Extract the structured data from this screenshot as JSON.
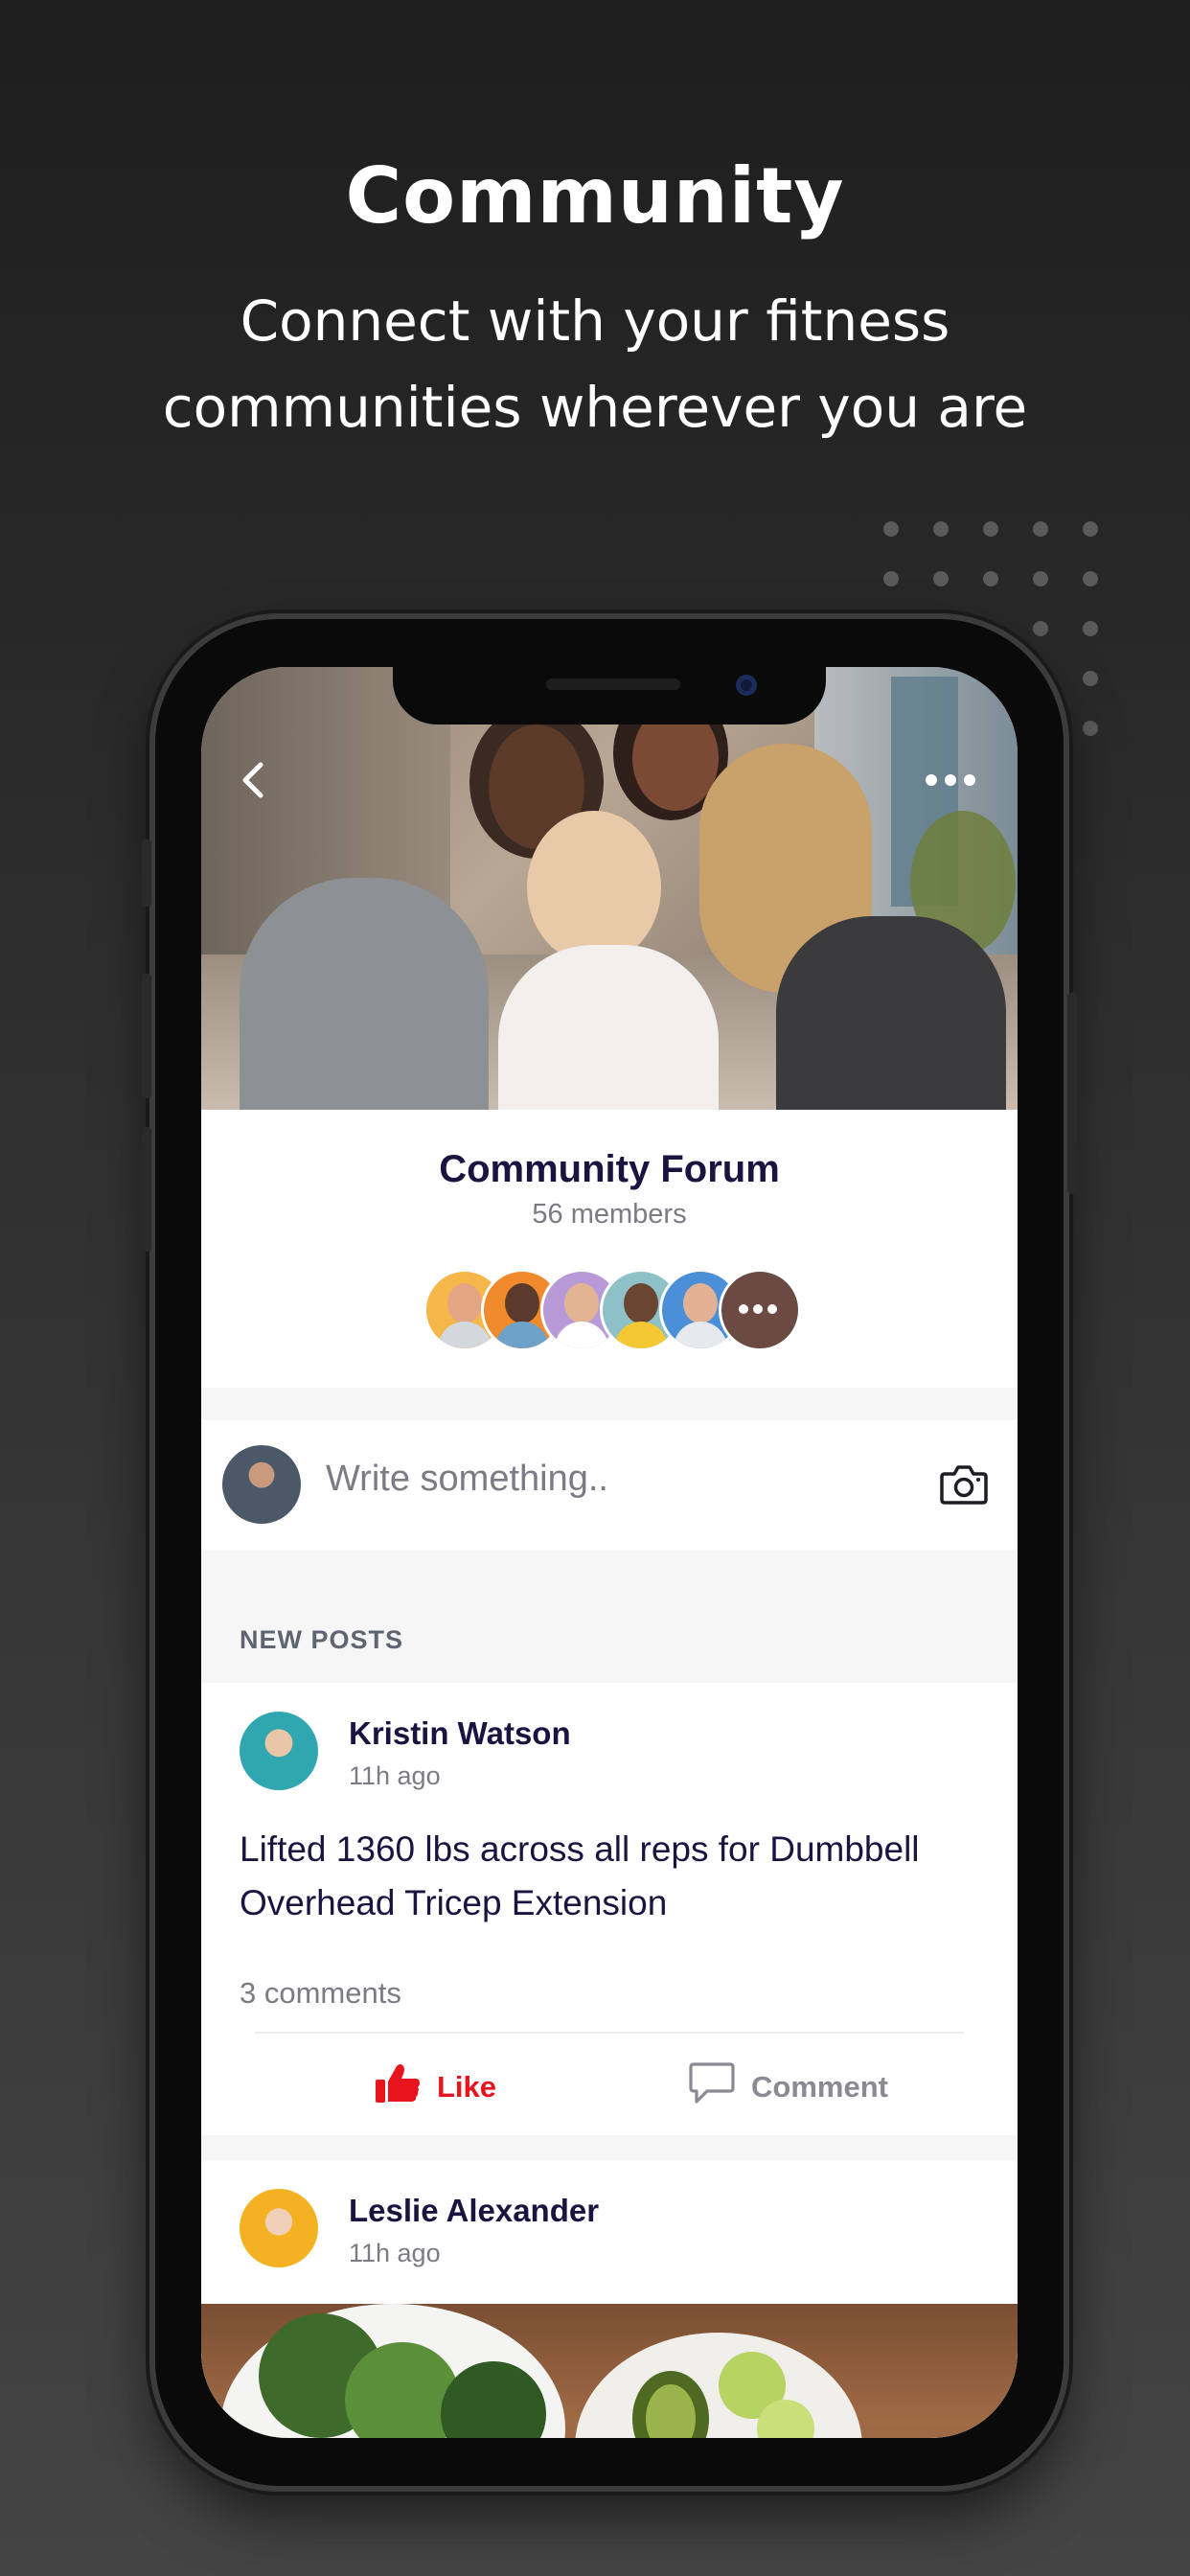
{
  "headline": "Community",
  "subtitle_line1": "Connect with your fitness",
  "subtitle_line2": "communities wherever you are",
  "group": {
    "name": "Community Forum",
    "members": "56 members"
  },
  "composer": {
    "placeholder": "Write something.."
  },
  "section_label": "NEW POSTS",
  "posts": [
    {
      "author": "Kristin Watson",
      "time": "11h ago",
      "text": "Lifted 1360 lbs across all reps for Dumbbell Overhead Tricep Extension",
      "comments": "3 comments",
      "like_label": "Like",
      "comment_label": "Comment"
    },
    {
      "author": "Leslie Alexander",
      "time": "11h ago"
    }
  ],
  "colors": {
    "accent_like": "#e8141d",
    "title_text": "#1c1440",
    "muted_text": "#7b7b86"
  },
  "icons": [
    "back-chevron-icon",
    "more-horizontal-icon",
    "camera-icon",
    "thumbs-up-icon",
    "speech-bubble-icon"
  ]
}
